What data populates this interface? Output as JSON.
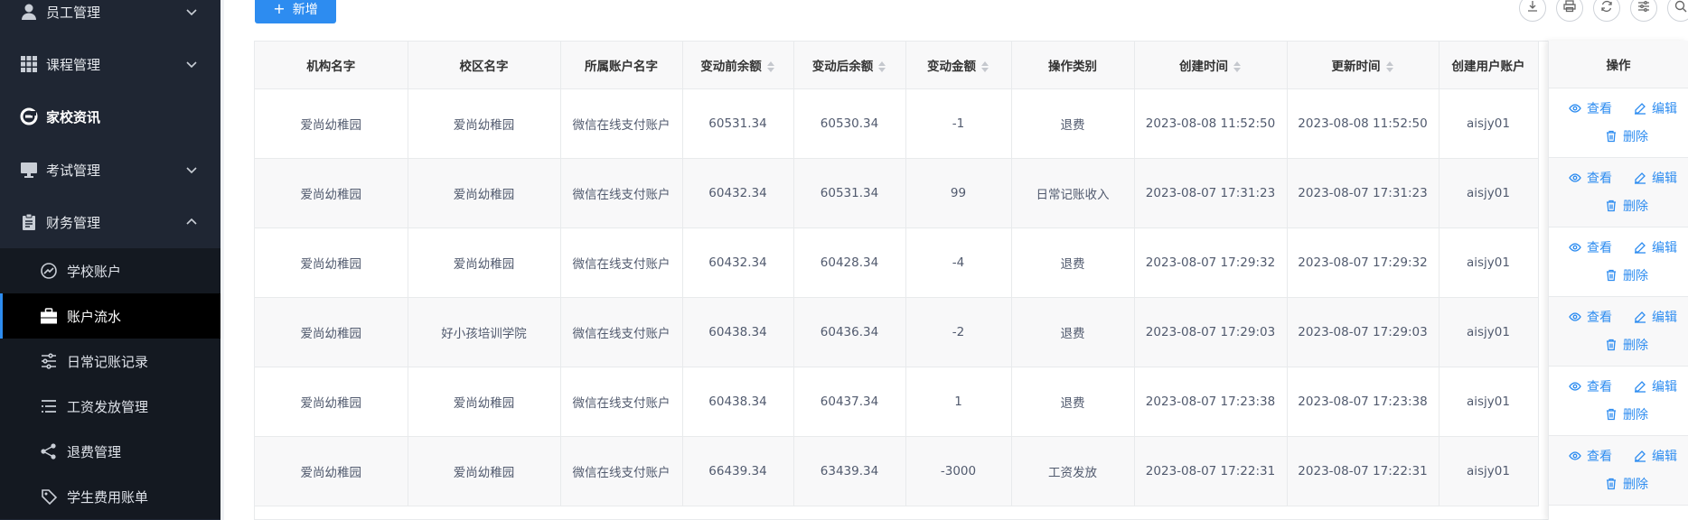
{
  "sidebar": {
    "items": [
      {
        "label": "员工管理",
        "icon": "user-icon",
        "expanded": false
      },
      {
        "label": "课程管理",
        "icon": "grid-icon",
        "expanded": false
      },
      {
        "label": "家校资讯",
        "icon": "news-icon"
      },
      {
        "label": "考试管理",
        "icon": "monitor-icon",
        "expanded": false
      },
      {
        "label": "财务管理",
        "icon": "clipboard-icon",
        "expanded": true
      }
    ],
    "finance_children": [
      {
        "label": "学校账户",
        "icon": "dashboard-icon"
      },
      {
        "label": "账户流水",
        "icon": "briefcase-icon",
        "active": true
      },
      {
        "label": "日常记账记录",
        "icon": "sliders-icon"
      },
      {
        "label": "工资发放管理",
        "icon": "list-icon"
      },
      {
        "label": "退费管理",
        "icon": "share-icon"
      },
      {
        "label": "学生费用账单",
        "icon": "tag-icon"
      }
    ]
  },
  "toolbar": {
    "add_label": "新增",
    "tools": [
      "download-icon",
      "print-icon",
      "refresh-icon",
      "settings-icon",
      "search-icon"
    ]
  },
  "table": {
    "columns": [
      "机构名字",
      "校区名字",
      "所属账户名字",
      "变动前余额",
      "变动后余额",
      "变动金额",
      "操作类别",
      "创建时间",
      "更新时间",
      "创建用户账户"
    ],
    "action_header": "操作",
    "actions": {
      "view": "查看",
      "edit": "编辑",
      "delete": "删除"
    },
    "rows": [
      [
        "爱尚幼稚园",
        "爱尚幼稚园",
        "微信在线支付账户",
        "60531.34",
        "60530.34",
        "-1",
        "退费",
        "2023-08-08 11:52:50",
        "2023-08-08 11:52:50",
        "aisjy01"
      ],
      [
        "爱尚幼稚园",
        "爱尚幼稚园",
        "微信在线支付账户",
        "60432.34",
        "60531.34",
        "99",
        "日常记账收入",
        "2023-08-07 17:31:23",
        "2023-08-07 17:31:23",
        "aisjy01"
      ],
      [
        "爱尚幼稚园",
        "爱尚幼稚园",
        "微信在线支付账户",
        "60432.34",
        "60428.34",
        "-4",
        "退费",
        "2023-08-07 17:29:32",
        "2023-08-07 17:29:32",
        "aisjy01"
      ],
      [
        "爱尚幼稚园",
        "好小孩培训学院",
        "微信在线支付账户",
        "60438.34",
        "60436.34",
        "-2",
        "退费",
        "2023-08-07 17:29:03",
        "2023-08-07 17:29:03",
        "aisjy01"
      ],
      [
        "爱尚幼稚园",
        "爱尚幼稚园",
        "微信在线支付账户",
        "60438.34",
        "60437.34",
        "1",
        "退费",
        "2023-08-07 17:23:38",
        "2023-08-07 17:23:38",
        "aisjy01"
      ],
      [
        "爱尚幼稚园",
        "爱尚幼稚园",
        "微信在线支付账户",
        "66439.34",
        "63439.34",
        "-3000",
        "工资发放",
        "2023-08-07 17:22:31",
        "2023-08-07 17:22:31",
        "aisjy01"
      ]
    ]
  },
  "colors": {
    "accent": "#2d8cf0",
    "sidebar_bg": "#1f2633",
    "submenu_bg": "#141921",
    "active_bg": "#000000"
  }
}
